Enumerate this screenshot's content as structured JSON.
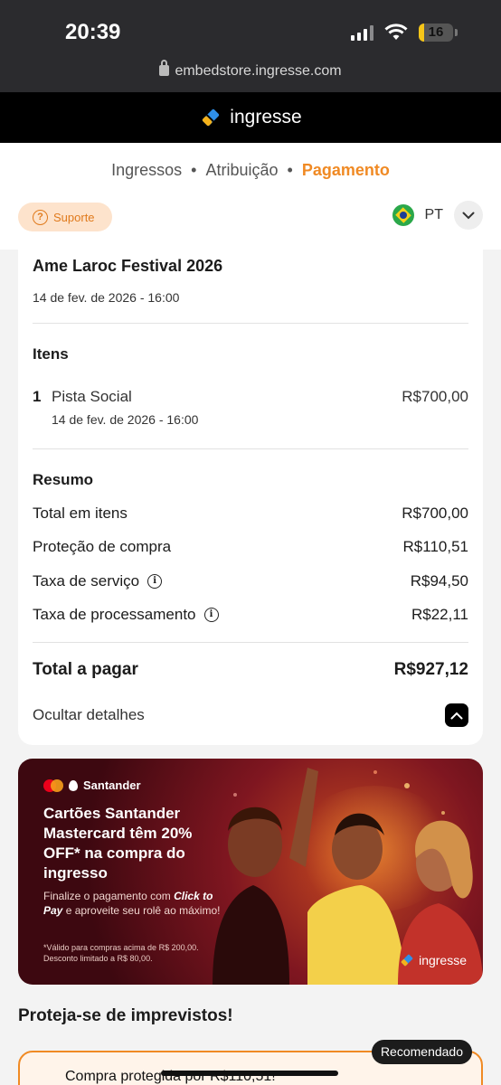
{
  "status": {
    "time": "20:39",
    "battery": "16",
    "battery_level": 0.16
  },
  "browser": {
    "url": "embedstore.ingresse.com"
  },
  "brand": {
    "name": "ingresse"
  },
  "steps": [
    {
      "label": "Ingressos",
      "active": false
    },
    {
      "label": "Atribuição",
      "active": false
    },
    {
      "label": "Pagamento",
      "active": true
    }
  ],
  "support": {
    "label": "Suporte"
  },
  "language": {
    "code": "PT"
  },
  "event": {
    "title": "Ame Laroc Festival 2026",
    "date": "14 de fev. de 2026 - 16:00"
  },
  "items": {
    "title": "Itens",
    "list": [
      {
        "qty": "1",
        "name": "Pista Social",
        "date": "14 de fev. de 2026 - 16:00",
        "price": "R$700,00"
      }
    ]
  },
  "summary": {
    "title": "Resumo",
    "rows": [
      {
        "label": "Total em itens",
        "value": "R$700,00",
        "info": false
      },
      {
        "label": "Proteção de compra",
        "value": "R$110,51",
        "info": false
      },
      {
        "label": "Taxa de serviço",
        "value": "R$94,50",
        "info": true
      },
      {
        "label": "Taxa de processamento",
        "value": "R$22,11",
        "info": true
      }
    ],
    "total_label": "Total a pagar",
    "total_value": "R$927,12",
    "toggle_label": "Ocultar detalhes"
  },
  "banner": {
    "brand": "Santander",
    "headline": "Cartões Santander Mastercard têm 20% OFF* na compra do ingresso",
    "sub_before": "Finalize o pagamento com",
    "sub_highlight": "Click to Pay",
    "sub_after": "e aproveite seu rolê ao máximo!",
    "note": "*Válido para compras acima de R$ 200,00. Desconto limitado a R$ 80,00.",
    "logo": "ingresse"
  },
  "protection": {
    "title": "Proteja-se de imprevistos!",
    "badge": "Recomendado",
    "text": "Compra protegida por R$110,51!"
  },
  "colors": {
    "accent": "#f08a24",
    "brand_bg": "#000000",
    "support_bg": "#fde3cc"
  }
}
